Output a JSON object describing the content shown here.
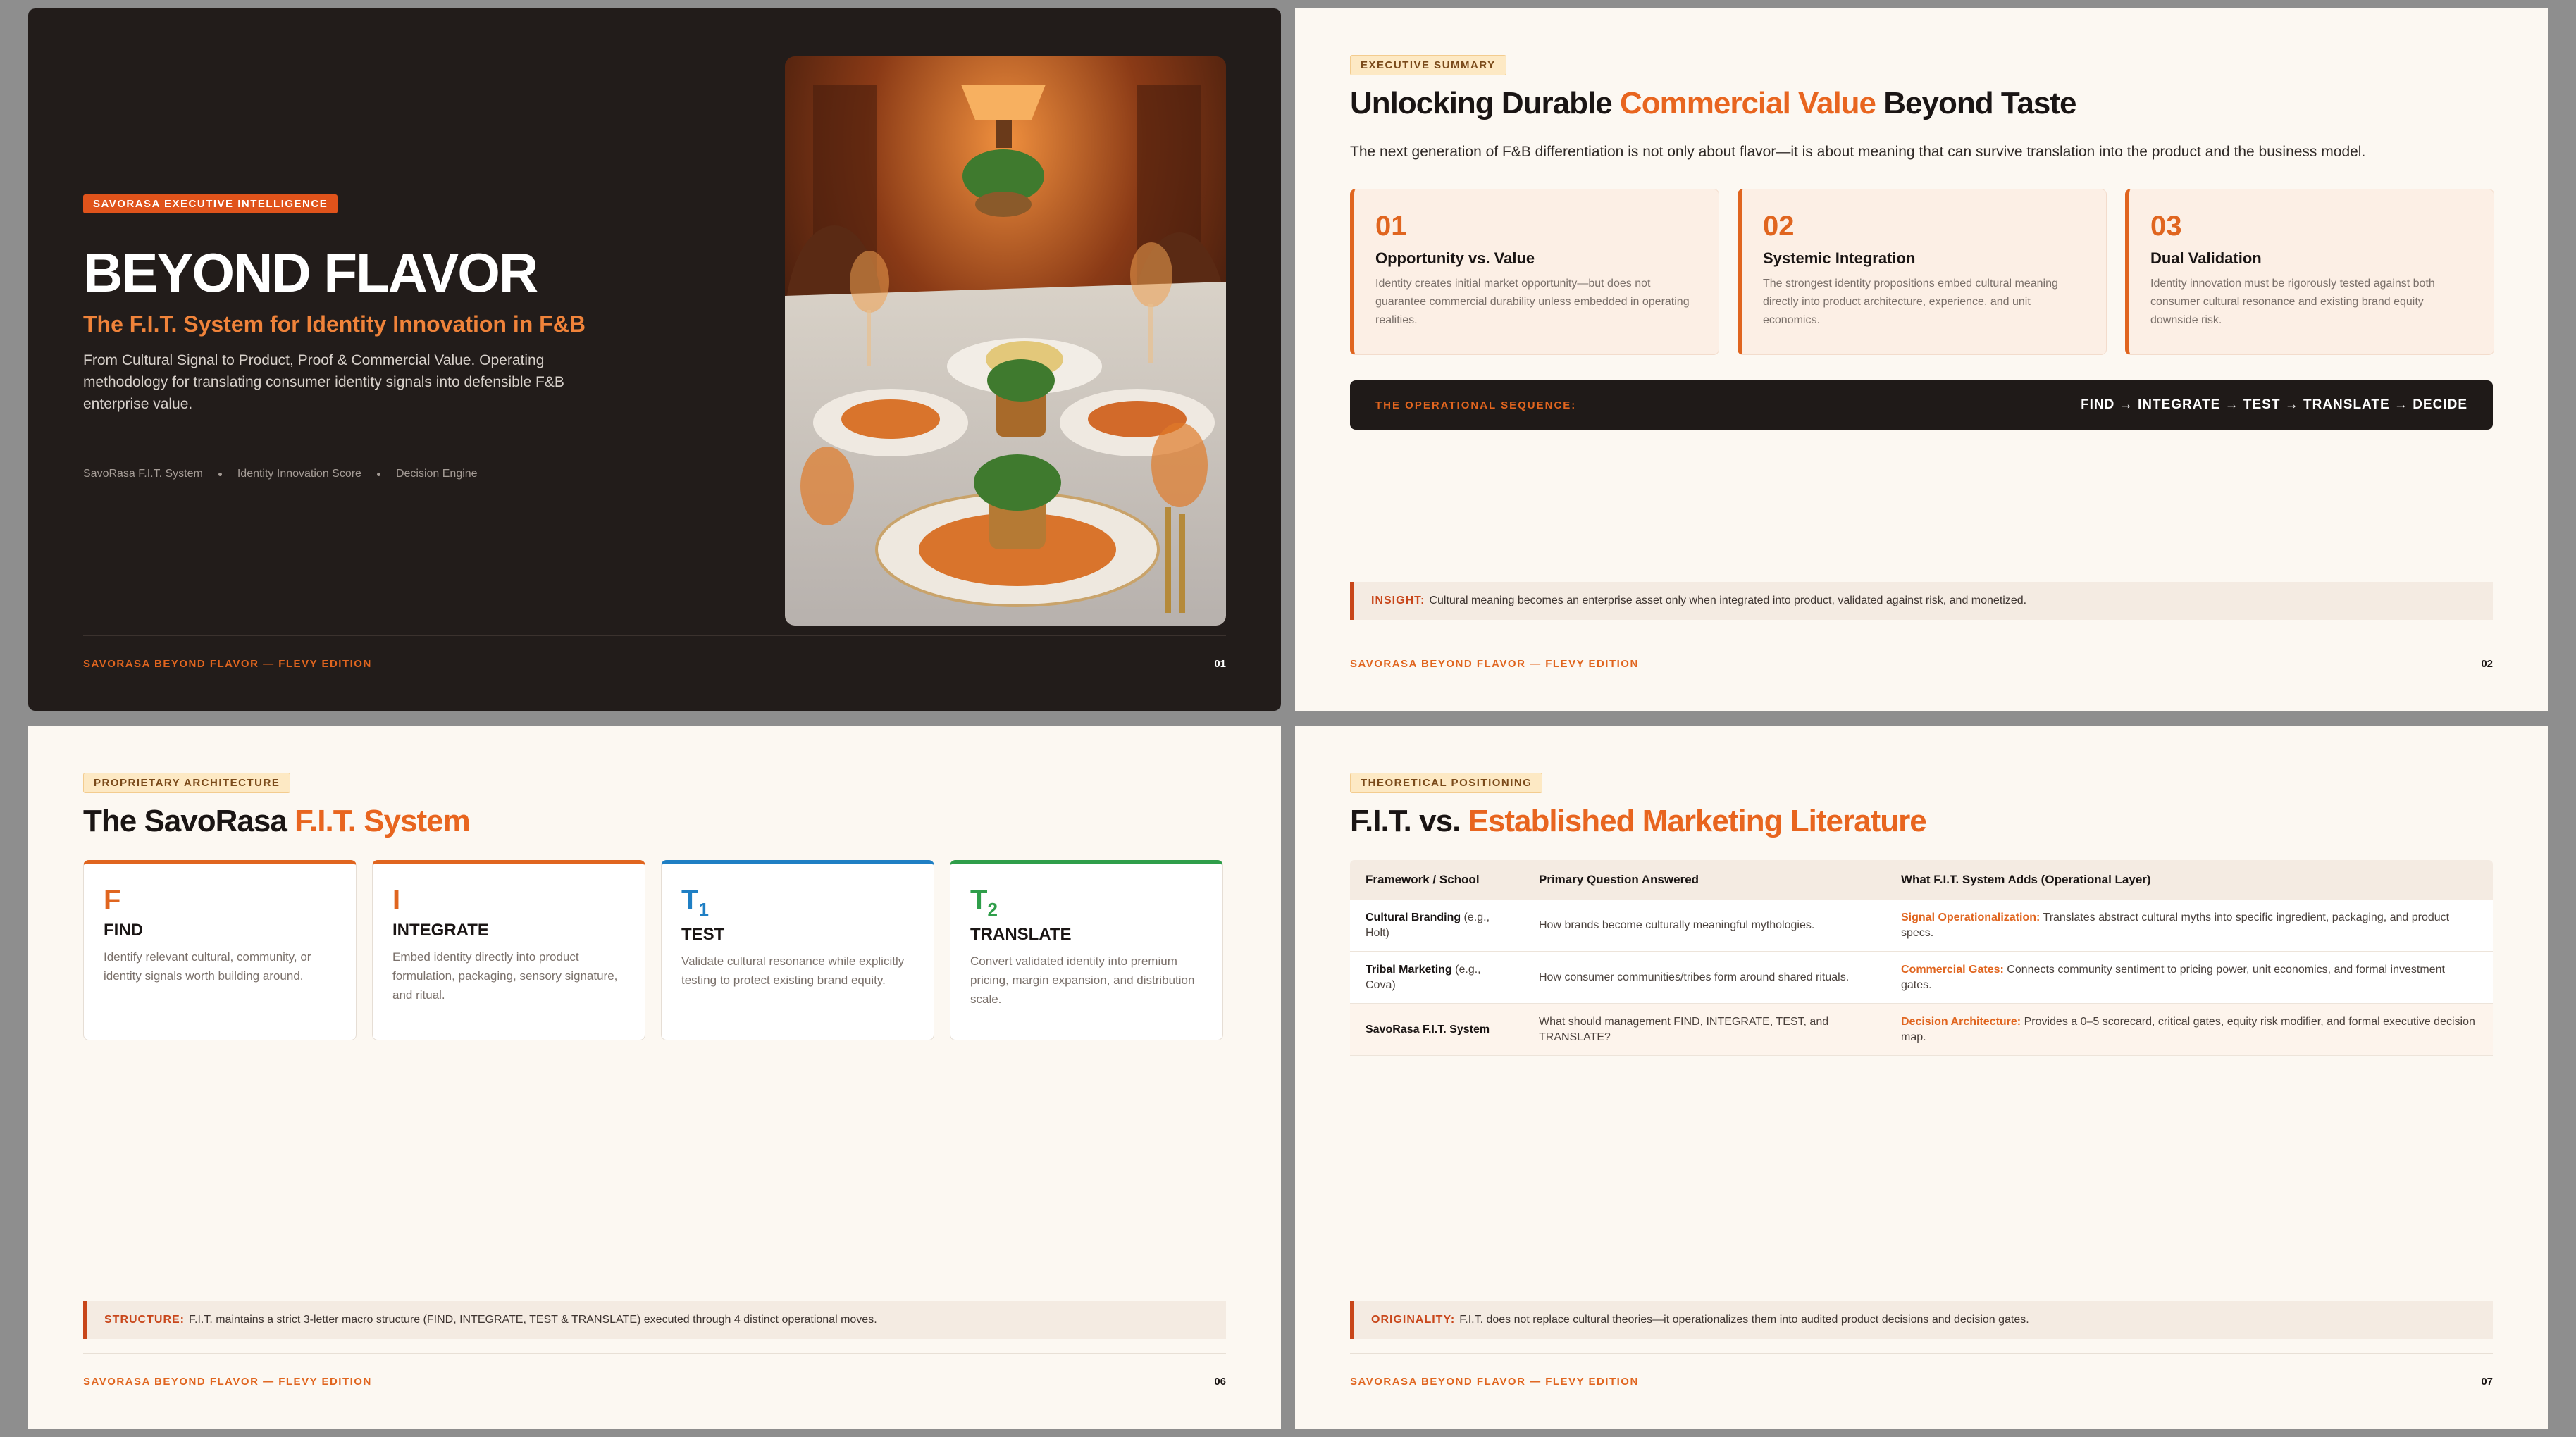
{
  "footer_brand": "SAVORASA BEYOND FLAVOR — FLEVY EDITION",
  "slide1": {
    "pill": "SAVORASA EXECUTIVE INTELLIGENCE",
    "title": "BEYOND FLAVOR",
    "subtitle": "The F.I.T. System for Identity Innovation in F&B",
    "description": "From Cultural Signal to Product, Proof & Commercial Value. Operating methodology for translating consumer identity signals into defensible F&B enterprise value.",
    "tags": [
      "SavoRasa F.I.T. System",
      "Identity Innovation Score",
      "Decision Engine"
    ],
    "page": "01"
  },
  "slide2": {
    "pill": "EXECUTIVE SUMMARY",
    "title_a": "Unlocking Durable ",
    "title_b": "Commercial Value",
    "title_c": " Beyond Taste",
    "lead": "The next generation of F&B differentiation is not only about flavor—it is about meaning that can survive translation into the product and the business model.",
    "cards": [
      {
        "num": "01",
        "title": "Opportunity vs. Value",
        "desc": "Identity creates initial market opportunity—but does not guarantee commercial durability unless embedded in operating realities."
      },
      {
        "num": "02",
        "title": "Systemic Integration",
        "desc": "The strongest identity propositions embed cultural meaning directly into product architecture, experience, and unit economics."
      },
      {
        "num": "03",
        "title": "Dual Validation",
        "desc": "Identity innovation must be rigorously tested against both consumer cultural resonance and existing brand equity downside risk."
      }
    ],
    "seq_label": "THE OPERATIONAL SEQUENCE:",
    "seq": "FIND → INTEGRATE → TEST → TRANSLATE → DECIDE",
    "insight_label": "INSIGHT:",
    "insight": "Cultural meaning becomes an enterprise asset only when integrated into product, validated against risk, and monetized.",
    "page": "02"
  },
  "slide3": {
    "pill": "PROPRIETARY ARCHITECTURE",
    "title_a": "The SavoRasa ",
    "title_b": "F.I.T. System",
    "cards": [
      {
        "letter": "F",
        "sub": "",
        "title": "FIND",
        "desc": "Identify relevant cultural, community, or identity signals worth building around.",
        "color": "#e0651f"
      },
      {
        "letter": "I",
        "sub": "",
        "title": "INTEGRATE",
        "desc": "Embed identity directly into product formulation, packaging, sensory signature, and ritual.",
        "color": "#e0651f"
      },
      {
        "letter": "T",
        "sub": "1",
        "title": "TEST",
        "desc": "Validate cultural resonance while explicitly testing to protect existing brand equity.",
        "color": "#1f7fc4"
      },
      {
        "letter": "T",
        "sub": "2",
        "title": "TRANSLATE",
        "desc": "Convert validated identity into premium pricing, margin expansion, and distribution scale.",
        "color": "#2f9e4a"
      }
    ],
    "structure_label": "STRUCTURE:",
    "structure": "F.I.T. maintains a strict 3-letter macro structure (FIND, INTEGRATE, TEST & TRANSLATE) executed through 4 distinct operational moves.",
    "page": "06"
  },
  "slide4": {
    "pill": "THEORETICAL POSITIONING",
    "title_a": "F.I.T. vs. ",
    "title_b": "Established Marketing Literature",
    "headers": [
      "Framework / School",
      "Primary Question Answered",
      "What F.I.T. System Adds (Operational Layer)"
    ],
    "rows": [
      {
        "framework": "Cultural Branding",
        "ref": " (e.g., Holt)",
        "question": "How brands become culturally meaningful mythologies.",
        "add_label": "Signal Operationalization:",
        "add": " Translates abstract cultural myths into specific ingredient, packaging, and product specs."
      },
      {
        "framework": "Tribal Marketing",
        "ref": " (e.g., Cova)",
        "question": "How consumer communities/tribes form around shared rituals.",
        "add_label": "Commercial Gates:",
        "add": " Connects community sentiment to pricing power, unit economics, and formal investment gates."
      },
      {
        "framework": "SavoRasa F.I.T. System",
        "ref": "",
        "question": "What should management FIND, INTEGRATE, TEST, and TRANSLATE?",
        "add_label": "Decision Architecture:",
        "add": " Provides a 0–5 scorecard, critical gates, equity risk modifier, and formal executive decision map."
      }
    ],
    "orig_label": "ORIGINALITY:",
    "orig": "F.I.T. does not replace cultural theories—it operationalizes them into audited product decisions and decision gates.",
    "page": "07"
  },
  "colors": {
    "accent": "#e0651f",
    "dark": "#221c1a",
    "cream": "#fcf8f2"
  }
}
